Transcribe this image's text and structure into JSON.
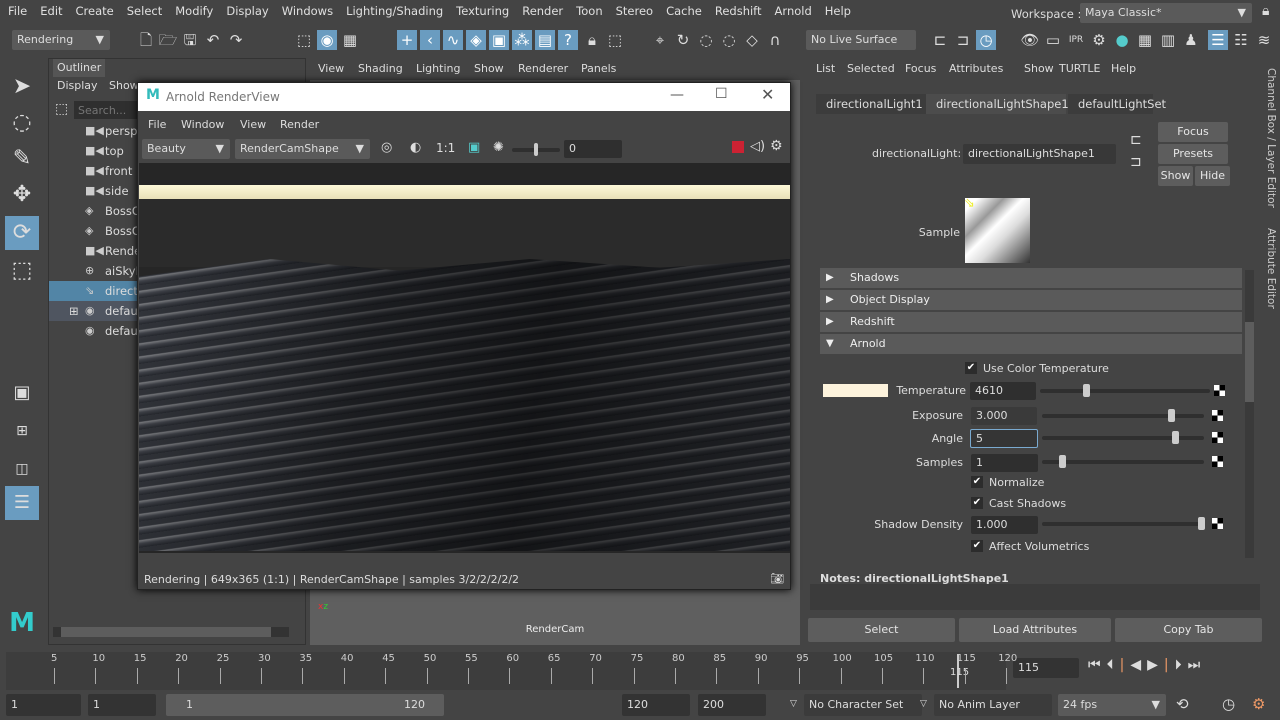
{
  "menubar": [
    "File",
    "Edit",
    "Create",
    "Select",
    "Modify",
    "Display",
    "Windows",
    "Lighting/Shading",
    "Texturing",
    "Render",
    "Toon",
    "Stereo",
    "Cache",
    "Redshift",
    "Arnold",
    "Help"
  ],
  "workspace": {
    "label": "Workspace :",
    "value": "Maya Classic*"
  },
  "toolbar": {
    "menuset": "Rendering",
    "live_surface": "No Live Surface"
  },
  "outliner": {
    "title": "Outliner",
    "menu": [
      "Display",
      "Show"
    ],
    "search_placeholder": "Search...",
    "items": [
      {
        "label": "persp",
        "icon": "camera-icon"
      },
      {
        "label": "top",
        "icon": "camera-icon"
      },
      {
        "label": "front",
        "icon": "camera-icon"
      },
      {
        "label": "side",
        "icon": "camera-icon"
      },
      {
        "label": "BossO",
        "icon": "mesh-icon"
      },
      {
        "label": "BossO",
        "icon": "mesh-icon"
      },
      {
        "label": "Rende",
        "icon": "camera-icon"
      },
      {
        "label": "aiSkyD",
        "icon": "sky-dome-icon"
      },
      {
        "label": "directi",
        "icon": "directional-light-icon",
        "selected": true
      },
      {
        "label": "defaul",
        "icon": "light-set-icon",
        "expandable": true
      },
      {
        "label": "defaul",
        "icon": "light-set-icon"
      }
    ]
  },
  "viewport": {
    "menu": [
      "View",
      "Shading",
      "Lighting",
      "Show",
      "Renderer",
      "Panels"
    ],
    "camera_label": "RenderCam"
  },
  "renderview": {
    "title": "Arnold RenderView",
    "menu": [
      "File",
      "Window",
      "View",
      "Render"
    ],
    "aov": "Beauty",
    "camera": "RenderCamShape",
    "ratio": "1:1",
    "exposure": "0",
    "status": "Rendering | 649x365 (1:1) | RenderCamShape  | samples 3/2/2/2/2/2"
  },
  "attribute_editor": {
    "menu": [
      "List",
      "Selected",
      "Focus",
      "Attributes",
      "Show",
      "TURTLE",
      "Help"
    ],
    "tabs": [
      "directionalLight1",
      "directionalLightShape1",
      "defaultLightSet"
    ],
    "node_label": "directionalLight:",
    "node_value": "directionalLightShape1",
    "buttons": {
      "focus": "Focus",
      "presets": "Presets",
      "show": "Show",
      "hide": "Hide"
    },
    "sample_label": "Sample",
    "sections": [
      "Shadows",
      "Object Display",
      "Redshift",
      "Arnold"
    ],
    "arnold": {
      "use_color_temperature": "Use Color Temperature",
      "temperature_label": "Temperature",
      "temperature": "4610",
      "temperature_color": "#fdf3dc",
      "exposure_label": "Exposure",
      "exposure": "3.000",
      "angle_label": "Angle",
      "angle": "5",
      "samples_label": "Samples",
      "samples": "1",
      "normalize": "Normalize",
      "cast_shadows": "Cast Shadows",
      "shadow_density_label": "Shadow Density",
      "shadow_density": "1.000",
      "affect_volumetrics": "Affect Volumetrics"
    },
    "notes": "Notes:  directionalLightShape1",
    "bottom_buttons": [
      "Select",
      "Load Attributes",
      "Copy Tab"
    ]
  },
  "side_tabs": [
    "Channel Box / Layer Editor",
    "Attribute Editor"
  ],
  "timeline": {
    "ticks": [
      "5",
      "10",
      "15",
      "20",
      "25",
      "30",
      "35",
      "40",
      "45",
      "50",
      "55",
      "60",
      "65",
      "70",
      "75",
      "80",
      "85",
      "90",
      "95",
      "100",
      "105",
      "110",
      "115",
      "120"
    ],
    "current_frame": "115",
    "current_marker": "115"
  },
  "range": {
    "start": "1",
    "playback_start": "1",
    "range_start": "1",
    "range_end": "120",
    "playback_end": "120",
    "end": "200",
    "character_set": "No Character Set",
    "anim_layer": "No Anim Layer",
    "fps": "24 fps"
  },
  "accent": "#6a9cc0"
}
